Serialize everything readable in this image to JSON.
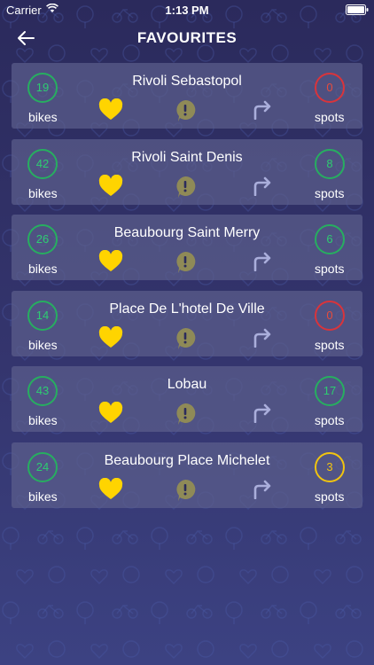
{
  "statusbar": {
    "carrier": "Carrier",
    "time": "1:13 PM"
  },
  "header": {
    "title": "FAVOURITES"
  },
  "labels": {
    "bikes": "bikes",
    "spots": "spots"
  },
  "colors": {
    "available": "#2ecc71",
    "empty": "#e74c3c",
    "low": "#f1c40f",
    "heart": "#ffd400",
    "alert": "#8f8a57"
  },
  "favourites": [
    {
      "station": "Rivoli Sebastopol",
      "bikes": "19",
      "spots": "0",
      "spots_status": "empty"
    },
    {
      "station": "Rivoli Saint Denis",
      "bikes": "42",
      "spots": "8",
      "spots_status": "available"
    },
    {
      "station": "Beaubourg Saint Merry",
      "bikes": "26",
      "spots": "6",
      "spots_status": "available"
    },
    {
      "station": "Place De L'hotel De Ville",
      "bikes": "14",
      "spots": "0",
      "spots_status": "empty"
    },
    {
      "station": "Lobau",
      "bikes": "43",
      "spots": "17",
      "spots_status": "available"
    },
    {
      "station": "Beaubourg Place Michelet",
      "bikes": "24",
      "spots": "3",
      "spots_status": "low"
    }
  ]
}
